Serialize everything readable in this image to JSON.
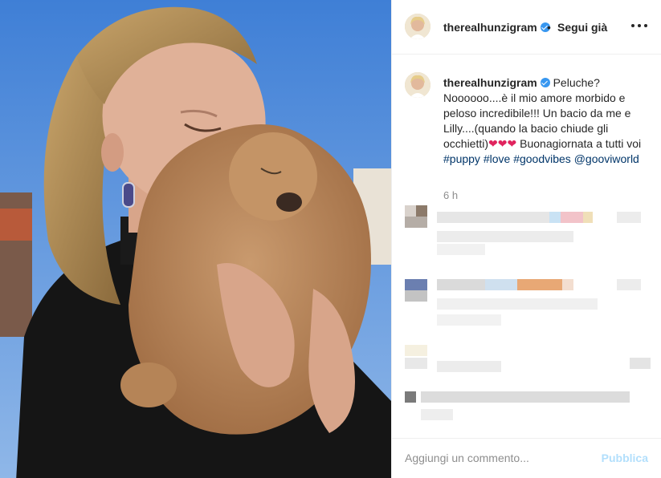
{
  "header": {
    "username": "therealhunzigram",
    "separator": "•",
    "follow_label": "Segui già",
    "more_icon": "more-horizontal-icon"
  },
  "caption": {
    "username": "therealhunzigram",
    "text_part1": "Peluche? Noooooo....è il mio amore morbido e peloso incredibile!!! Un bacio da me e Lilly....(quando la bacio chiude gli occhietti)",
    "hearts": "❤❤❤",
    "text_part2": " Buonagiornata a tutti voi",
    "hashtags": [
      "#puppy",
      "#love",
      "#goodvibes"
    ],
    "mention": "@gooviworld",
    "time": "6 h"
  },
  "footer": {
    "comment_placeholder": "Aggiungi un commento...",
    "publish_label": "Pubblica"
  },
  "colors": {
    "link": "#003569",
    "publish_disabled": "#b2dffc",
    "verified": "#3897f0",
    "sky": "#5b8fd8"
  }
}
